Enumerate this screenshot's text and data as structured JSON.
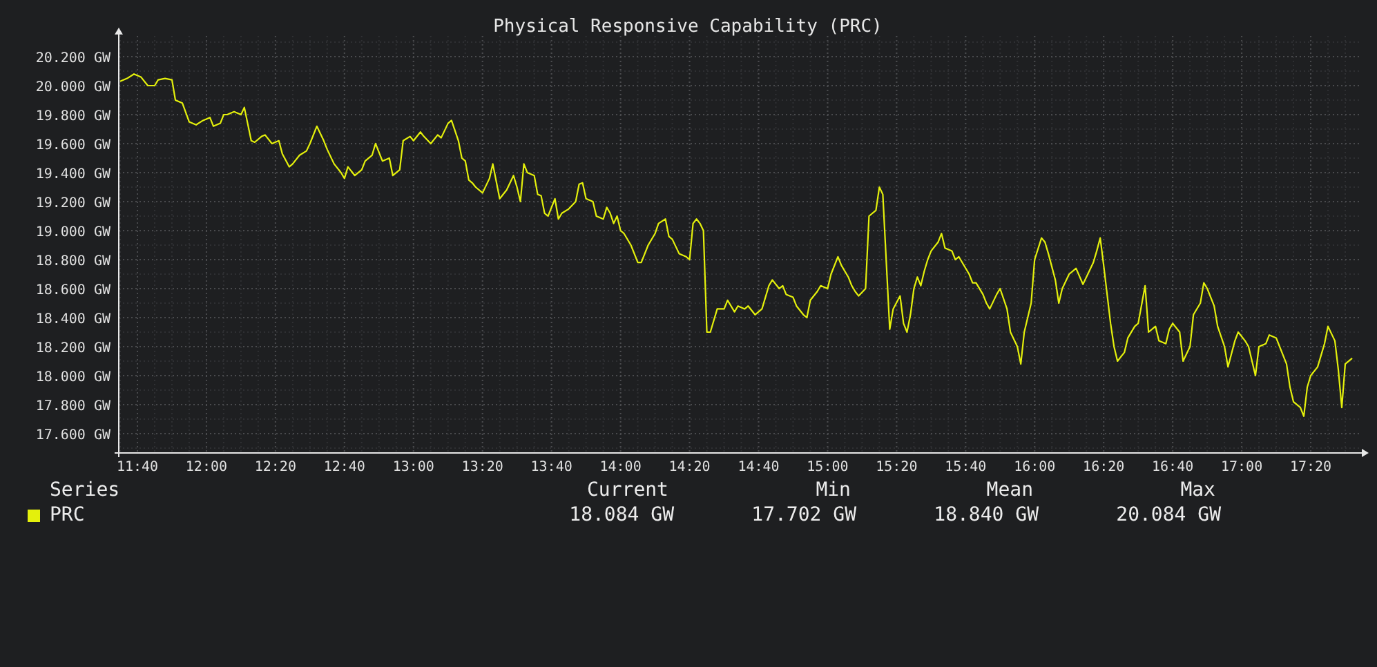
{
  "chart": {
    "chart_data": {
      "type": "line",
      "title": "Physical Responsive Capability (PRC)",
      "grid": true,
      "xlim": [
        694.6,
        1054.4
      ],
      "ylim": [
        17.467,
        20.343
      ],
      "xticks": [
        {
          "value": 700,
          "label": "11:40"
        },
        {
          "value": 720,
          "label": "12:00"
        },
        {
          "value": 740,
          "label": "12:20"
        },
        {
          "value": 760,
          "label": "12:40"
        },
        {
          "value": 780,
          "label": "13:00"
        },
        {
          "value": 800,
          "label": "13:20"
        },
        {
          "value": 820,
          "label": "13:40"
        },
        {
          "value": 840,
          "label": "14:00"
        },
        {
          "value": 860,
          "label": "14:20"
        },
        {
          "value": 880,
          "label": "14:40"
        },
        {
          "value": 900,
          "label": "15:00"
        },
        {
          "value": 920,
          "label": "15:20"
        },
        {
          "value": 940,
          "label": "15:40"
        },
        {
          "value": 960,
          "label": "16:00"
        },
        {
          "value": 980,
          "label": "16:20"
        },
        {
          "value": 1000,
          "label": "16:40"
        },
        {
          "value": 1020,
          "label": "17:00"
        },
        {
          "value": 1040,
          "label": "17:20"
        }
      ],
      "yticks": [
        {
          "value": 17.6,
          "label": "17.600 GW"
        },
        {
          "value": 17.8,
          "label": "17.800 GW"
        },
        {
          "value": 18.0,
          "label": "18.000 GW"
        },
        {
          "value": 18.2,
          "label": "18.200 GW"
        },
        {
          "value": 18.4,
          "label": "18.400 GW"
        },
        {
          "value": 18.6,
          "label": "18.600 GW"
        },
        {
          "value": 18.8,
          "label": "18.800 GW"
        },
        {
          "value": 19.0,
          "label": "19.000 GW"
        },
        {
          "value": 19.2,
          "label": "19.200 GW"
        },
        {
          "value": 19.4,
          "label": "19.400 GW"
        },
        {
          "value": 19.6,
          "label": "19.600 GW"
        },
        {
          "value": 19.8,
          "label": "19.800 GW"
        },
        {
          "value": 20.0,
          "label": "20.000 GW"
        },
        {
          "value": 20.2,
          "label": "20.200 GW"
        }
      ],
      "x": [
        695,
        697,
        699,
        701,
        703,
        705,
        706,
        708,
        710,
        711,
        713,
        715,
        717,
        719,
        721,
        722,
        724,
        725,
        726,
        728,
        730,
        731,
        733,
        734,
        736,
        737,
        739,
        741,
        742,
        744,
        745,
        747,
        749,
        750,
        752,
        754,
        755,
        757,
        759,
        760,
        761,
        763,
        765,
        766,
        768,
        769,
        771,
        773,
        774,
        776,
        777,
        779,
        780,
        782,
        783,
        785,
        787,
        788,
        790,
        791,
        793,
        794,
        795,
        796,
        797,
        798,
        800,
        802,
        803,
        805,
        807,
        809,
        810,
        811,
        812,
        813,
        815,
        816,
        817,
        818,
        819,
        821,
        822,
        823,
        825,
        827,
        828,
        829,
        830,
        832,
        833,
        835,
        836,
        837,
        838,
        839,
        840,
        841,
        843,
        845,
        846,
        848,
        850,
        851,
        853,
        854,
        855,
        857,
        859,
        860,
        861,
        862,
        863,
        864,
        865,
        866,
        868,
        870,
        871,
        873,
        874,
        876,
        877,
        879,
        881,
        882,
        883,
        884,
        886,
        887,
        888,
        890,
        891,
        893,
        894,
        895,
        897,
        898,
        900,
        901,
        903,
        904,
        906,
        907,
        908,
        909,
        911,
        912,
        914,
        915,
        916,
        918,
        919,
        921,
        922,
        923,
        924,
        925,
        926,
        927,
        928,
        929,
        930,
        932,
        933,
        934,
        936,
        937,
        938,
        939,
        941,
        942,
        943,
        945,
        946,
        947,
        949,
        950,
        952,
        953,
        955,
        956,
        957,
        959,
        960,
        962,
        963,
        964,
        966,
        967,
        968,
        970,
        971,
        972,
        974,
        975,
        977,
        978,
        979,
        980,
        982,
        983,
        984,
        986,
        987,
        989,
        990,
        992,
        993,
        995,
        996,
        998,
        999,
        1000,
        1002,
        1003,
        1005,
        1006,
        1008,
        1009,
        1010,
        1012,
        1013,
        1015,
        1016,
        1018,
        1019,
        1021,
        1022,
        1024,
        1025,
        1027,
        1028,
        1030,
        1031,
        1033,
        1034,
        1035,
        1037,
        1038,
        1039,
        1040,
        1042,
        1043,
        1044,
        1045,
        1047,
        1048,
        1049,
        1050,
        1052
      ],
      "series": [
        {
          "name": "PRC",
          "color": "#e4f00c",
          "values": [
            20.03,
            20.05,
            20.08,
            20.06,
            20.0,
            20.0,
            20.04,
            20.05,
            20.04,
            19.9,
            19.88,
            19.75,
            19.73,
            19.76,
            19.78,
            19.72,
            19.74,
            19.8,
            19.8,
            19.82,
            19.8,
            19.85,
            19.62,
            19.61,
            19.65,
            19.66,
            19.6,
            19.62,
            19.53,
            19.44,
            19.46,
            19.52,
            19.55,
            19.6,
            19.72,
            19.62,
            19.56,
            19.46,
            19.4,
            19.36,
            19.44,
            19.38,
            19.42,
            19.48,
            19.52,
            19.6,
            19.48,
            19.5,
            19.38,
            19.42,
            19.62,
            19.65,
            19.62,
            19.68,
            19.65,
            19.6,
            19.66,
            19.64,
            19.74,
            19.76,
            19.62,
            19.5,
            19.48,
            19.35,
            19.33,
            19.3,
            19.26,
            19.36,
            19.46,
            19.22,
            19.28,
            19.38,
            19.3,
            19.2,
            19.46,
            19.4,
            19.38,
            19.25,
            19.24,
            19.12,
            19.1,
            19.22,
            19.08,
            19.12,
            19.15,
            19.2,
            19.32,
            19.33,
            19.22,
            19.2,
            19.1,
            19.08,
            19.16,
            19.12,
            19.05,
            19.1,
            19.0,
            18.98,
            18.9,
            18.78,
            18.78,
            18.9,
            18.98,
            19.05,
            19.08,
            18.96,
            18.94,
            18.84,
            18.82,
            18.8,
            19.05,
            19.08,
            19.05,
            19.0,
            18.3,
            18.3,
            18.46,
            18.46,
            18.52,
            18.44,
            18.48,
            18.46,
            18.48,
            18.42,
            18.46,
            18.54,
            18.62,
            18.66,
            18.6,
            18.62,
            18.56,
            18.54,
            18.48,
            18.42,
            18.4,
            18.52,
            18.58,
            18.62,
            18.6,
            18.7,
            18.82,
            18.76,
            18.68,
            18.62,
            18.58,
            18.55,
            18.6,
            19.1,
            19.14,
            19.3,
            19.25,
            18.32,
            18.46,
            18.55,
            18.36,
            18.3,
            18.42,
            18.6,
            18.68,
            18.62,
            18.72,
            18.8,
            18.86,
            18.92,
            18.98,
            18.88,
            18.86,
            18.8,
            18.82,
            18.78,
            18.7,
            18.64,
            18.64,
            18.56,
            18.5,
            18.46,
            18.56,
            18.6,
            18.46,
            18.3,
            18.2,
            18.08,
            18.3,
            18.5,
            18.8,
            18.95,
            18.92,
            18.84,
            18.66,
            18.5,
            18.6,
            18.7,
            18.72,
            18.74,
            18.63,
            18.68,
            18.78,
            18.86,
            18.95,
            18.76,
            18.36,
            18.2,
            18.1,
            18.16,
            18.26,
            18.34,
            18.36,
            18.62,
            18.3,
            18.34,
            18.24,
            18.22,
            18.32,
            18.36,
            18.3,
            18.1,
            18.2,
            18.42,
            18.5,
            18.64,
            18.6,
            18.48,
            18.34,
            18.2,
            18.06,
            18.24,
            18.3,
            18.24,
            18.2,
            18.0,
            18.2,
            18.22,
            18.28,
            18.26,
            18.2,
            18.08,
            17.92,
            17.82,
            17.78,
            17.72,
            17.92,
            18.0,
            18.06,
            18.14,
            18.22,
            18.34,
            18.24,
            18.04,
            17.78,
            18.08,
            18.12
          ]
        }
      ]
    }
  },
  "legend": {
    "columns": [
      "Series",
      "Current",
      "Min",
      "Mean",
      "Max"
    ],
    "rows": [
      {
        "current": "18.084 GW",
        "min": "17.702 GW",
        "mean": "18.840 GW",
        "max": "20.084 GW"
      }
    ]
  }
}
